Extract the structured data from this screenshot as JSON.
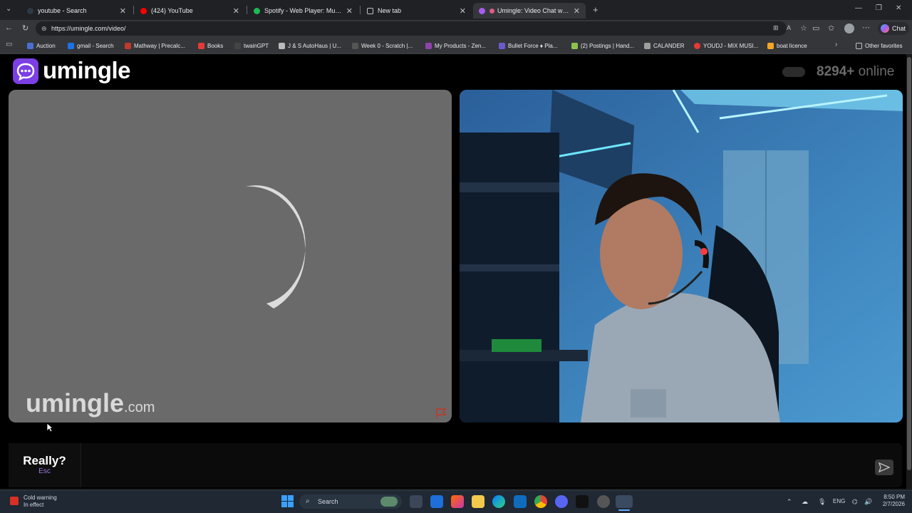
{
  "browser": {
    "tabs": [
      {
        "title": "youtube - Search",
        "icon": "search-favicon",
        "color": "#2d3947",
        "active": false
      },
      {
        "title": "(424) YouTube",
        "icon": "youtube-favicon",
        "color": "#ff0000",
        "active": false
      },
      {
        "title": "Spotify - Web Player: Music for ev...",
        "icon": "spotify-favicon",
        "color": "#1db954",
        "active": false
      },
      {
        "title": "New tab",
        "icon": "newtab-favicon",
        "color": "#bdc1c6",
        "active": false
      },
      {
        "title": "Umingle: Video Chat with Str...",
        "icon": "umingle-favicon",
        "color": "#a65cf0",
        "active": true
      }
    ],
    "url": "https://umingle.com/video/",
    "chat_button": "Chat",
    "bookmarks": [
      {
        "label": "Auction",
        "color": "#4a6fd1"
      },
      {
        "label": "gmail - Search",
        "color": "#1a73e8"
      },
      {
        "label": "Mathway | Precalc...",
        "color": "#c0392b"
      },
      {
        "label": "Books",
        "color": "#e53935"
      },
      {
        "label": "twainGPT",
        "color": "#444"
      },
      {
        "label": "J & S AutoHaus | U...",
        "color": "#bbbbbb"
      },
      {
        "label": "Week 0 - Scratch |...",
        "color": "#555"
      },
      {
        "label": "My Products - Zen...",
        "color": "#8e44ad"
      },
      {
        "label": "Bullet Force ♦ Pla...",
        "color": "#6a5acd"
      },
      {
        "label": "(2) Postings | Hand...",
        "color": "#8bc34a"
      },
      {
        "label": "CALANDER",
        "color": "#9e9e9e"
      },
      {
        "label": "YOUDJ - MIX MUSI...",
        "color": "#e53935"
      },
      {
        "label": "boat licence",
        "color": "#f5a623"
      }
    ],
    "other_favorites": "Other favorites"
  },
  "site": {
    "logo_text": "umingle",
    "online_count": "8294+",
    "online_label": "online",
    "watermark_name": "umingle",
    "watermark_domain": ".com",
    "stop_button": {
      "label": "Really?",
      "shortcut": "Esc"
    },
    "chat_placeholder": "",
    "accent": "#7b3fe4"
  },
  "taskbar": {
    "weather_title": "Cold warning",
    "weather_sub": "In effect",
    "search_label": "Search",
    "language": "ENG",
    "time": "8:50 PM",
    "date": "2/7/2026"
  }
}
